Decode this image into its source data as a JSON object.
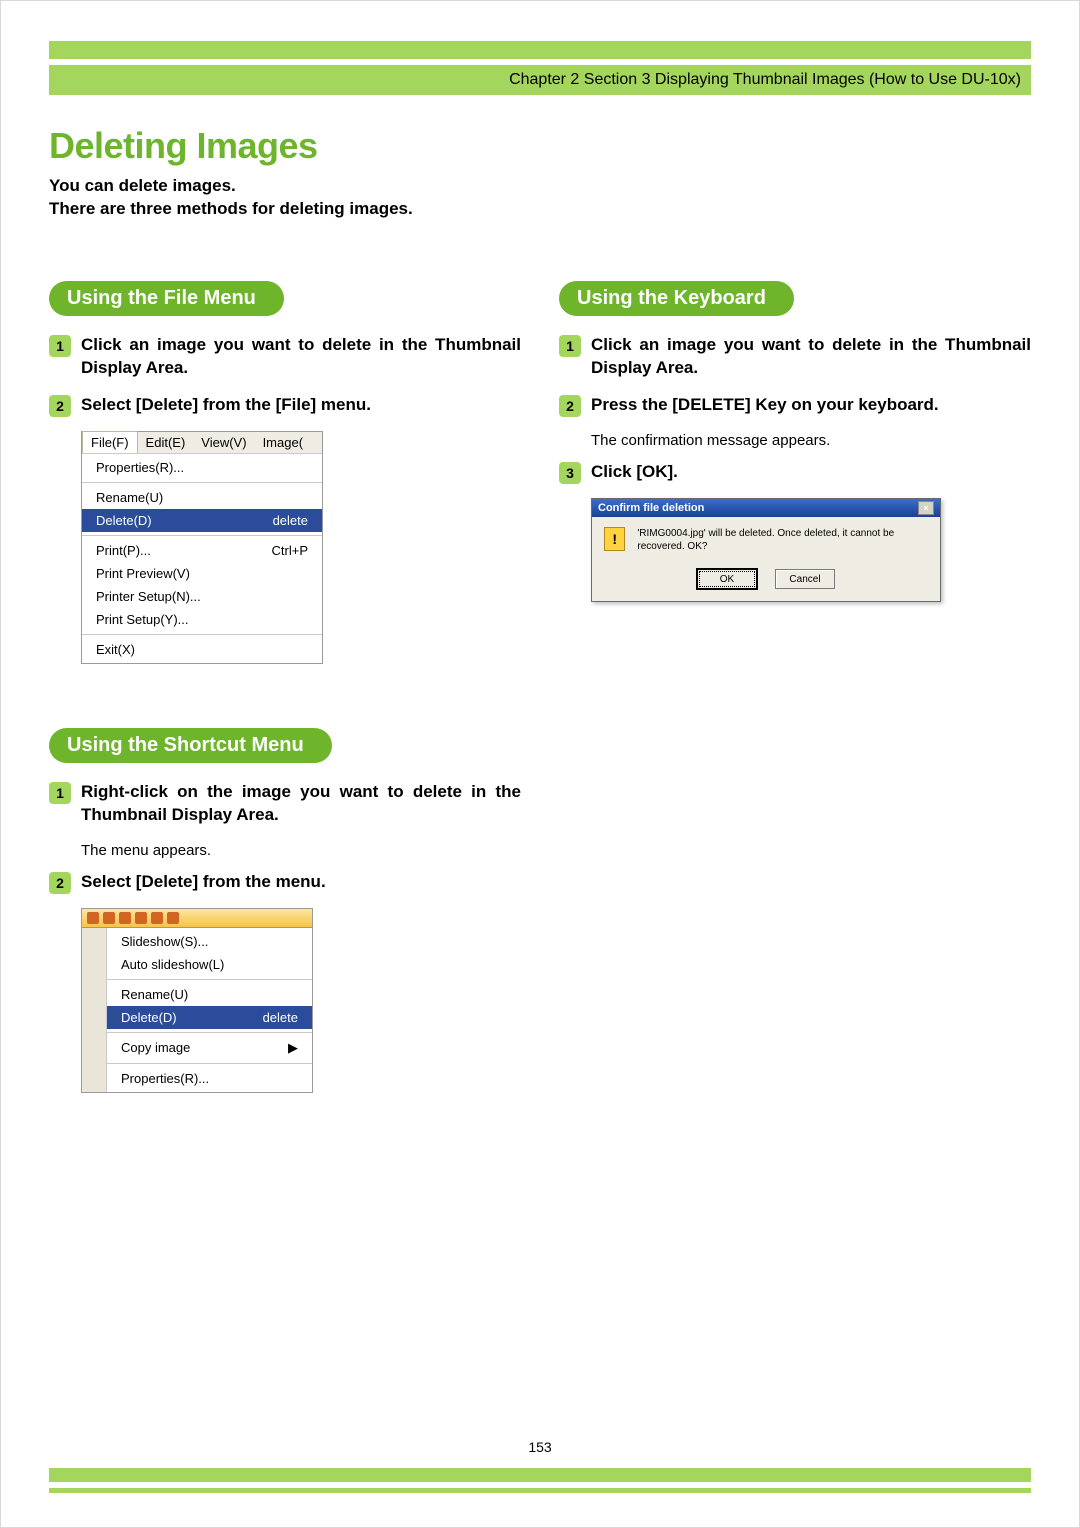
{
  "breadcrumb": "Chapter 2 Section 3 Displaying Thumbnail Images (How to Use DU-10x)",
  "title": "Deleting Images",
  "intro_line1": "You can delete images.",
  "intro_line2": "There are three methods for deleting images.",
  "sections": {
    "file_menu": {
      "heading": "Using the File Menu",
      "steps": [
        "Click an image you want to delete in the Thumbnail Display Area.",
        "Select [Delete] from the [File] menu."
      ],
      "menu": {
        "menubar": [
          "File(F)",
          "Edit(E)",
          "View(V)",
          "Image("
        ],
        "items": [
          {
            "label": "Properties(R)...",
            "shortcut": ""
          },
          {
            "sep": true
          },
          {
            "label": "Rename(U)",
            "shortcut": ""
          },
          {
            "label": "Delete(D)",
            "shortcut": "delete",
            "highlight": true
          },
          {
            "sep": true
          },
          {
            "label": "Print(P)...",
            "shortcut": "Ctrl+P"
          },
          {
            "label": "Print Preview(V)",
            "shortcut": ""
          },
          {
            "label": "Printer Setup(N)...",
            "shortcut": ""
          },
          {
            "label": "Print Setup(Y)...",
            "shortcut": ""
          },
          {
            "sep": true
          },
          {
            "label": "Exit(X)",
            "shortcut": ""
          }
        ]
      }
    },
    "keyboard": {
      "heading": "Using the Keyboard",
      "steps": [
        "Click an image you want to delete in the Thumbnail Display Area.",
        "Press the [DELETE] Key on your keyboard.",
        "Click [OK]."
      ],
      "step2_note": "The confirmation message appears.",
      "dialog": {
        "title": "Confirm file deletion",
        "message": "'RIMG0004.jpg' will be deleted. Once deleted, it cannot be recovered. OK?",
        "ok": "OK",
        "cancel": "Cancel"
      }
    },
    "shortcut": {
      "heading": "Using the Shortcut Menu",
      "steps": [
        "Right-click on the image you want to delete in the Thumbnail Display Area.",
        "Select [Delete] from the menu."
      ],
      "step1_note": "The menu appears.",
      "menu": {
        "items": [
          {
            "label": "Slideshow(S)...",
            "shortcut": ""
          },
          {
            "label": "Auto slideshow(L)",
            "shortcut": ""
          },
          {
            "sep": true
          },
          {
            "label": "Rename(U)",
            "shortcut": ""
          },
          {
            "label": "Delete(D)",
            "shortcut": "delete",
            "highlight": true
          },
          {
            "sep": true
          },
          {
            "label": "Copy image",
            "shortcut": "▶"
          },
          {
            "sep": true
          },
          {
            "label": "Properties(R)...",
            "shortcut": ""
          }
        ]
      }
    }
  },
  "page_number": "153"
}
